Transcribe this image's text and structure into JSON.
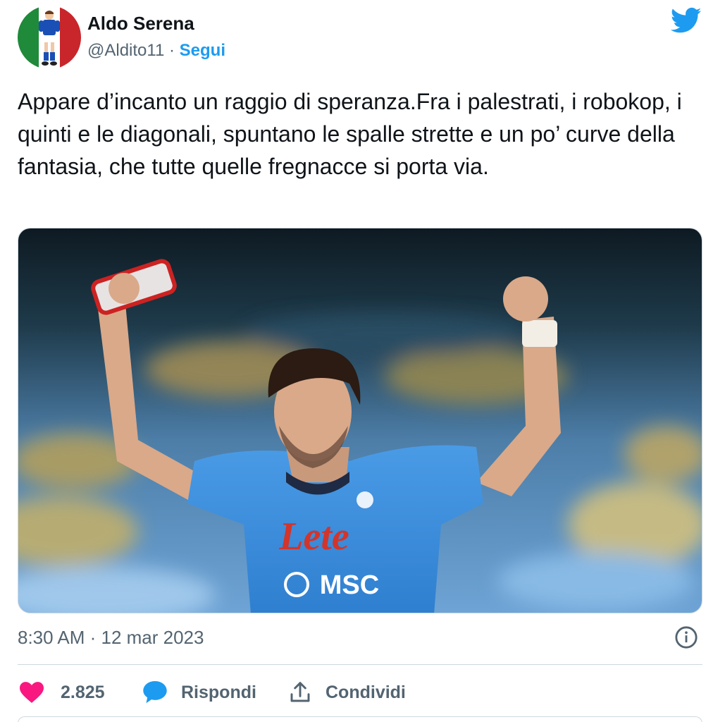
{
  "author": {
    "name": "Aldo Serena",
    "handle": "@Aldito11",
    "separator": " · ",
    "follow_label": "Segui"
  },
  "tweet": {
    "text": "Appare d’incanto un raggio di speranza.Fra i palestrati, i robokop, i quinti e le diagonali, spuntano le spalle strette e un po’ curve della fantasia, che tutte quelle fregnacce si porta via."
  },
  "media": {
    "sponsor_top": "Lete",
    "sponsor_bottom": "MSC"
  },
  "meta": {
    "timestamp": "8:30 AM · 12 mar 2023"
  },
  "actions": {
    "likes_count": "2.825",
    "reply_label": "Rispondi",
    "share_label": "Condividi"
  },
  "colors": {
    "accent": "#1d9bf0",
    "like": "#f91880",
    "secondary_text": "#536471",
    "jersey": "#3d8fe0"
  },
  "icons": [
    "twitter-bird-icon",
    "info-icon",
    "heart-icon",
    "reply-bubble-icon",
    "share-icon"
  ]
}
